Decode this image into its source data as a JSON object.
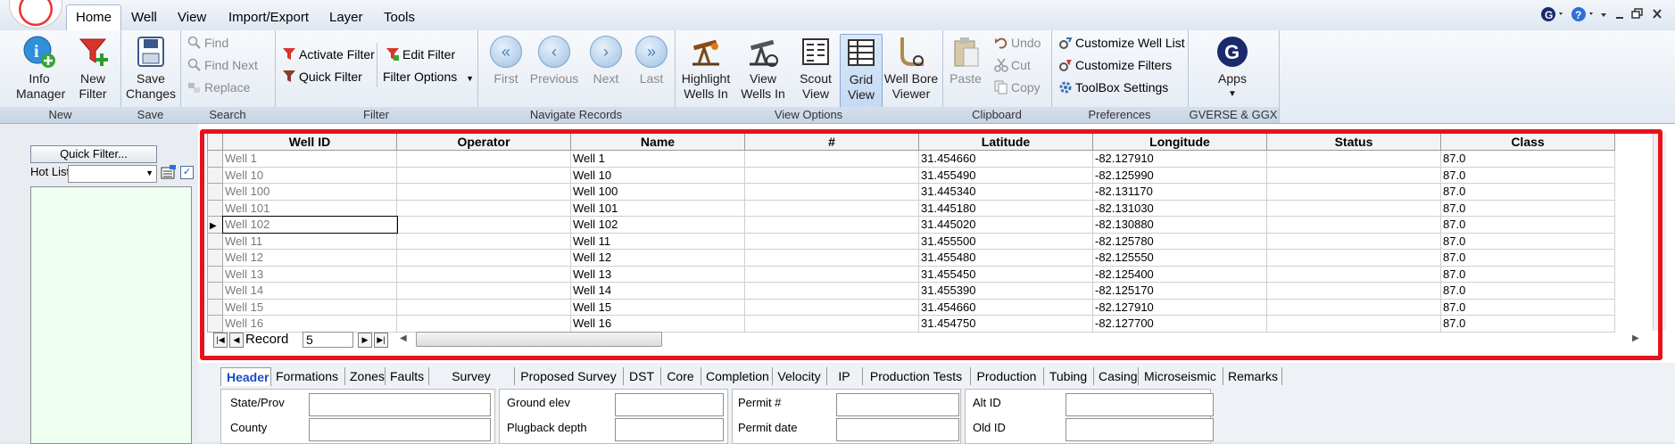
{
  "menu": {
    "tabs": [
      "Home",
      "Well",
      "View",
      "Import/Export",
      "Layer",
      "Tools"
    ],
    "active": "Home"
  },
  "ribbon": {
    "new_group": {
      "label": "New",
      "info": [
        "Info",
        "Manager"
      ],
      "new_filter": [
        "New",
        "Filter"
      ]
    },
    "save_group": {
      "label": "Save",
      "save": [
        "Save",
        "Changes"
      ]
    },
    "search_group": {
      "label": "Search",
      "find": "Find",
      "find_next": "Find Next",
      "replace": "Replace"
    },
    "filter_group": {
      "label": "Filter",
      "activate": "Activate Filter",
      "edit": "Edit Filter",
      "quick": "Quick Filter",
      "options": "Filter Options"
    },
    "navigate_group": {
      "label": "Navigate Records",
      "first": "First",
      "previous": "Previous",
      "next": "Next",
      "last": "Last"
    },
    "view_group": {
      "label": "View Options",
      "highlight": [
        "Highlight",
        "Wells In"
      ],
      "view_wells": [
        "View",
        "Wells In"
      ],
      "scout": [
        "Scout",
        "View"
      ],
      "grid": [
        "Grid",
        "View"
      ],
      "wellbore": [
        "Well Bore",
        "Viewer"
      ]
    },
    "clipboard_group": {
      "label": "Clipboard",
      "paste": "Paste",
      "undo": "Undo",
      "cut": "Cut",
      "copy": "Copy"
    },
    "prefs_group": {
      "label": "Preferences",
      "customize_list": "Customize Well List",
      "customize_filters": "Customize Filters",
      "toolbox": "ToolBox Settings"
    },
    "apps_group": {
      "label": "GVERSE & GGX",
      "apps": "Apps"
    }
  },
  "left_panel": {
    "quick_filter_button": "Quick Filter...",
    "hot_list_label": "Hot List",
    "hot_list_value": ""
  },
  "grid": {
    "columns": [
      "Well ID",
      "Operator",
      "Name",
      "#",
      "Latitude",
      "Longitude",
      "Status",
      "Class"
    ],
    "rows": [
      {
        "id": "Well 1",
        "operator": "",
        "name": "Well 1",
        "num": "",
        "lat": "31.454660",
        "lon": "-82.127910",
        "status": "",
        "class": "87.0"
      },
      {
        "id": "Well 10",
        "operator": "",
        "name": "Well 10",
        "num": "",
        "lat": "31.455490",
        "lon": "-82.125990",
        "status": "",
        "class": "87.0"
      },
      {
        "id": "Well 100",
        "operator": "",
        "name": "Well 100",
        "num": "",
        "lat": "31.445340",
        "lon": "-82.131170",
        "status": "",
        "class": "87.0"
      },
      {
        "id": "Well 101",
        "operator": "",
        "name": "Well 101",
        "num": "",
        "lat": "31.445180",
        "lon": "-82.131030",
        "status": "",
        "class": "87.0"
      },
      {
        "id": "Well 102",
        "operator": "",
        "name": "Well 102",
        "num": "",
        "lat": "31.445020",
        "lon": "-82.130880",
        "status": "",
        "class": "87.0"
      },
      {
        "id": "Well 11",
        "operator": "",
        "name": "Well 11",
        "num": "",
        "lat": "31.455500",
        "lon": "-82.125780",
        "status": "",
        "class": "87.0"
      },
      {
        "id": "Well 12",
        "operator": "",
        "name": "Well 12",
        "num": "",
        "lat": "31.455480",
        "lon": "-82.125550",
        "status": "",
        "class": "87.0"
      },
      {
        "id": "Well 13",
        "operator": "",
        "name": "Well 13",
        "num": "",
        "lat": "31.455450",
        "lon": "-82.125400",
        "status": "",
        "class": "87.0"
      },
      {
        "id": "Well 14",
        "operator": "",
        "name": "Well 14",
        "num": "",
        "lat": "31.455390",
        "lon": "-82.125170",
        "status": "",
        "class": "87.0"
      },
      {
        "id": "Well 15",
        "operator": "",
        "name": "Well 15",
        "num": "",
        "lat": "31.454660",
        "lon": "-82.127910",
        "status": "",
        "class": "87.0"
      },
      {
        "id": "Well 16",
        "operator": "",
        "name": "Well 16",
        "num": "",
        "lat": "31.454750",
        "lon": "-82.127700",
        "status": "",
        "class": "87.0"
      }
    ],
    "current_row_index": 4,
    "record_label": "Record",
    "record_value": "5"
  },
  "detail_tabs": [
    "Header",
    "Formations",
    "Zones",
    "Faults",
    "Survey",
    "Proposed Survey",
    "DST",
    "Core",
    "Completion",
    "Velocity",
    "IP",
    "Production Tests",
    "Production",
    "Tubing",
    "Casing",
    "Microseismic",
    "Remarks"
  ],
  "detail_active": "Header",
  "detail_fields": [
    {
      "label": "State/Prov",
      "value": ""
    },
    {
      "label": "County",
      "value": ""
    },
    {
      "label": "Ground elev",
      "value": ""
    },
    {
      "label": "Plugback depth",
      "value": ""
    },
    {
      "label": "Permit #",
      "value": ""
    },
    {
      "label": "Permit date",
      "value": ""
    },
    {
      "label": "Alt ID",
      "value": ""
    },
    {
      "label": "Old ID",
      "value": ""
    }
  ],
  "colors": {
    "highlight_border": "#e8121c",
    "accent": "#1a4cc8"
  }
}
